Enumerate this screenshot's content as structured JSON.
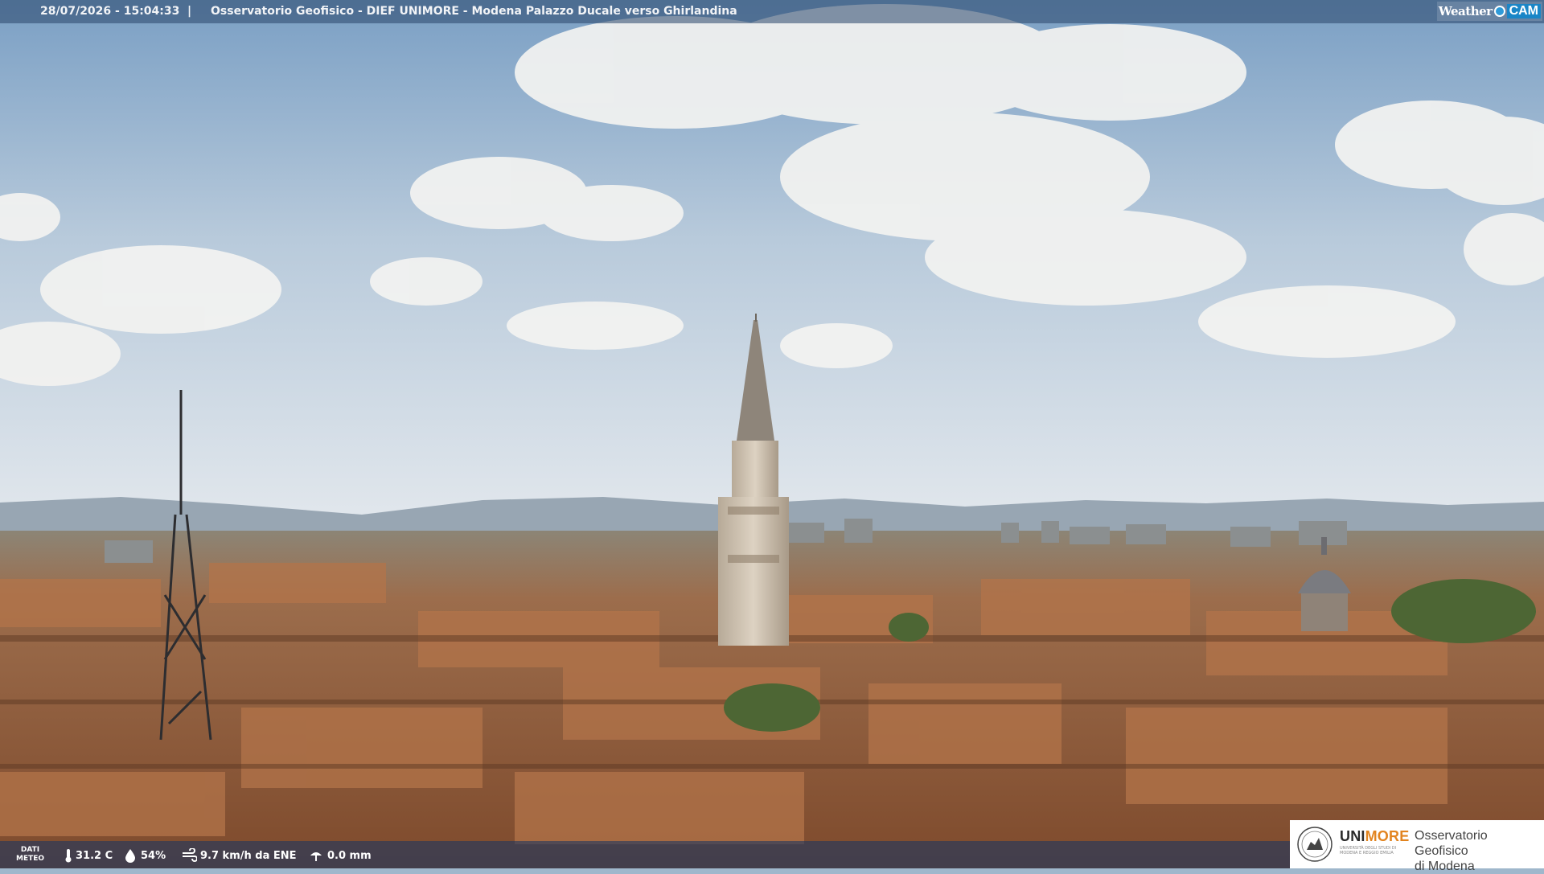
{
  "header": {
    "timestamp": "28/07/2026 - 15:04:33",
    "separator": "|",
    "caption": "Osservatorio Geofisico - DIEF UNIMORE - Modena Palazzo Ducale verso Ghirlandina"
  },
  "brand": {
    "weather_label": "Weather",
    "cam_label": "CAM",
    "accent": "#1a86c7"
  },
  "weather_bar": {
    "dati_line1": "DATI",
    "dati_line2": "METEO",
    "temperature": "31.2 C",
    "humidity": "54%",
    "wind": "9.7 km/h da ENE",
    "rain": "0.0 mm",
    "icons": [
      "thermometer-icon",
      "humidity-icon",
      "wind-icon",
      "rain-gauge-icon"
    ]
  },
  "footer_logo": {
    "uni": "UNI",
    "more": "MORE",
    "uni_small": "UNIVERSITÀ DEGLI STUDI DI MODENA E REGGIO EMILIA",
    "obs_line1": "Osservatorio Geofisico",
    "obs_line2": "di Modena",
    "more_color": "#e2841f"
  },
  "colors": {
    "sky_top": "#7fa3c6",
    "sky_horizon": "#dfe6ec",
    "roof": "#a8683f"
  }
}
